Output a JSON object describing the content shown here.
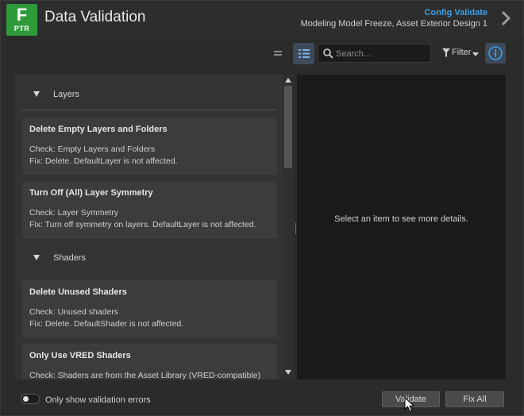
{
  "header": {
    "logo_letter": "F",
    "logo_sub": "PTR",
    "title": "Data Validation",
    "config_link": "Config Validate",
    "config_sub": "Modeling Model Freeze, Asset Exterior Design 1"
  },
  "toolbar": {
    "search_placeholder": "Search...",
    "filter_label": "Filter"
  },
  "groups": [
    {
      "title": "Layers",
      "items": [
        {
          "title": "Delete Empty Layers and Folders",
          "check": "Check: Empty Layers and Folders",
          "fix": "Fix: Delete. DefaultLayer is not affected."
        },
        {
          "title": "Turn Off (All) Layer Symmetry",
          "check": "Check: Layer Symmetry",
          "fix": "Fix: Turn off symmetry on layers. DefaultLayer is not affected."
        }
      ]
    },
    {
      "title": "Shaders",
      "items": [
        {
          "title": "Delete Unused Shaders",
          "check": "Check: Unused shaders",
          "fix": "Fix: Delete. DefaultShader is not affected."
        },
        {
          "title": "Only Use VRED Shaders",
          "check": "Check: Shaders are from the Asset Library (VRED-compatible)",
          "fix": ""
        }
      ]
    }
  ],
  "details": {
    "empty_message": "Select an item to see more details."
  },
  "footer": {
    "toggle_label": "Only show validation errors",
    "validate_label": "Validate",
    "fixall_label": "Fix All"
  },
  "colors": {
    "accent": "#3aa0e8",
    "logo": "#2e9a3a"
  }
}
